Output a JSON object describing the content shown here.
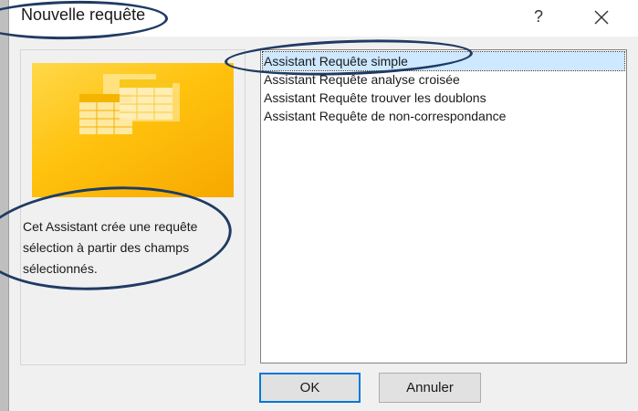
{
  "dialog": {
    "title": "Nouvelle requête",
    "help_glyph": "?",
    "accent_color": "#0078d7"
  },
  "preview": {
    "description": "Cet Assistant crée une requête sélection à partir des champs sélectionnés."
  },
  "wizards": {
    "items": [
      {
        "label": "Assistant Requête simple",
        "selected": true
      },
      {
        "label": "Assistant Requête analyse croisée",
        "selected": false
      },
      {
        "label": "Assistant Requête trouver les doublons",
        "selected": false
      },
      {
        "label": "Assistant Requête de non-correspondance",
        "selected": false
      }
    ]
  },
  "buttons": {
    "ok_label": "OK",
    "cancel_label": "Annuler"
  },
  "annotations": {
    "color": "#1f3b63"
  }
}
